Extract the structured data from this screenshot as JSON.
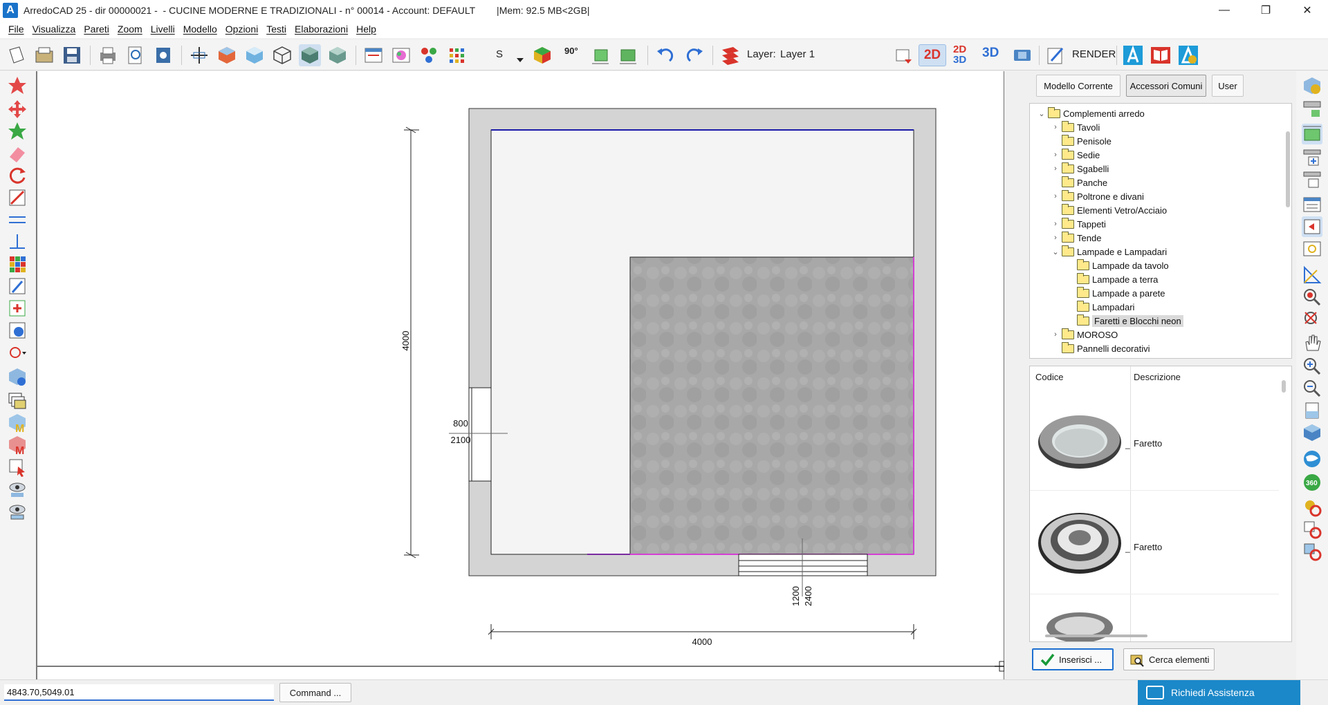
{
  "window": {
    "app_letter": "A",
    "title": "ArredoCAD 25 - dir 00000021 -  - CUCINE MODERNE E TRADIZIONALI - n° 00014 - Account: DEFAULT        |Mem: 92.5 MB<2GB|",
    "controls": [
      "minimize-icon",
      "maximize-icon",
      "close-icon"
    ],
    "minimize": "—",
    "maximize": "❐",
    "close": "✕"
  },
  "menu": [
    "File",
    "Visualizza",
    "Pareti",
    "Zoom",
    "Livelli",
    "Modello",
    "Opzioni",
    "Testi",
    "Elaborazioni",
    "Help"
  ],
  "toolbar": {
    "s_label": "S",
    "angle_label": "90°",
    "layer_label": "Layer:",
    "layer_value": "Layer 1",
    "view_2d": "2D",
    "view_2d3d_top": "2D",
    "view_2d3d_bottom": "3D",
    "view_3d": "3D",
    "render_label": "RENDER",
    "colors": {
      "accent": "#1d6fd1",
      "red": "#d9342b",
      "green": "#3aa845"
    }
  },
  "drawing": {
    "dim_height": "4000",
    "dim_width": "4000",
    "door_width": "800",
    "door_height": "2100",
    "window_width": "1200",
    "window_height": "2400",
    "colors": {
      "wall": "#d4d4d4",
      "floor": "#f4f4f4",
      "tile": "#a9a9a9",
      "blue_edge": "#1a1aa8",
      "magenta_edge": "#d43fd4"
    }
  },
  "panel": {
    "tabs": [
      {
        "label": "Modello Corrente",
        "active": false
      },
      {
        "label": "Accessori Comuni",
        "active": true
      },
      {
        "label": "User",
        "active": false
      }
    ],
    "tree": [
      {
        "label": "Complementi arredo",
        "level": 0,
        "expand": "open",
        "open_folder": true
      },
      {
        "label": "Tavoli",
        "level": 1,
        "expand": "closed"
      },
      {
        "label": "Penisole",
        "level": 1,
        "expand": "none"
      },
      {
        "label": "Sedie",
        "level": 1,
        "expand": "closed"
      },
      {
        "label": "Sgabelli",
        "level": 1,
        "expand": "closed"
      },
      {
        "label": "Panche",
        "level": 1,
        "expand": "none"
      },
      {
        "label": "Poltrone e divani",
        "level": 1,
        "expand": "closed"
      },
      {
        "label": "Elementi Vetro/Acciaio",
        "level": 1,
        "expand": "none"
      },
      {
        "label": "Tappeti",
        "level": 1,
        "expand": "closed"
      },
      {
        "label": "Tende",
        "level": 1,
        "expand": "closed"
      },
      {
        "label": "Lampade e Lampadari",
        "level": 1,
        "expand": "open",
        "open_folder": true
      },
      {
        "label": "Lampade da tavolo",
        "level": 2,
        "expand": "none"
      },
      {
        "label": "Lampade a terra",
        "level": 2,
        "expand": "none"
      },
      {
        "label": "Lampade a parete",
        "level": 2,
        "expand": "none"
      },
      {
        "label": "Lampadari",
        "level": 2,
        "expand": "none"
      },
      {
        "label": "Faretti e Blocchi neon",
        "level": 2,
        "expand": "none",
        "selected": true
      },
      {
        "label": "MOROSO",
        "level": 1,
        "expand": "closed"
      },
      {
        "label": "Pannelli decorativi",
        "level": 1,
        "expand": "none"
      }
    ],
    "columns": {
      "code": "Codice",
      "description": "Descrizione"
    },
    "items": [
      {
        "code_suffix": "_",
        "description": "Faretto",
        "icon": "recessed-spotlight-icon"
      },
      {
        "code_suffix": "_",
        "description": "Faretto",
        "icon": "ring-spotlight-icon"
      },
      {
        "code_suffix": "",
        "description": "",
        "icon": "spotlight-partial-icon"
      }
    ],
    "insert_label": "Inserisci ...",
    "search_label": "Cerca elementi"
  },
  "status": {
    "coords": "4843.70,5049.01",
    "command_label": "Command ...",
    "assist_label": "Richiedi Assistenza"
  }
}
